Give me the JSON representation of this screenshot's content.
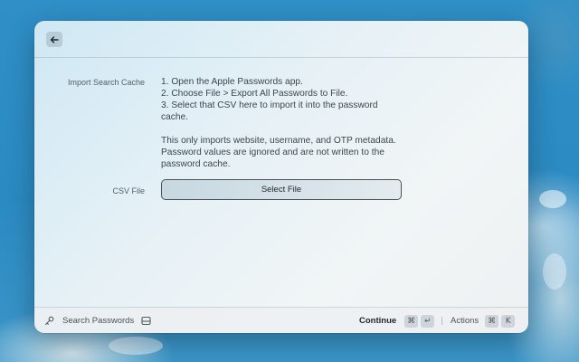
{
  "header": {
    "back_icon": "arrow-left-icon"
  },
  "form": {
    "import": {
      "label": "Import Search Cache",
      "instructions": "1. Open the Apple Passwords app.\n2. Choose File > Export All Passwords to File.\n3. Select that CSV here to import it into the password cache.",
      "note": "This only imports website, username, and OTP metadata. Password values are ignored and are not written to the password cache."
    },
    "csv": {
      "label": "CSV File",
      "button_label": "Select File"
    }
  },
  "footer": {
    "search_label": "Search Passwords",
    "search_icon": "key-icon",
    "extension_icon": "inbox-icon",
    "continue_label": "Continue",
    "continue_keys": [
      "⌘",
      "↵"
    ],
    "actions_label": "Actions",
    "actions_keys": [
      "⌘",
      "K"
    ]
  }
}
